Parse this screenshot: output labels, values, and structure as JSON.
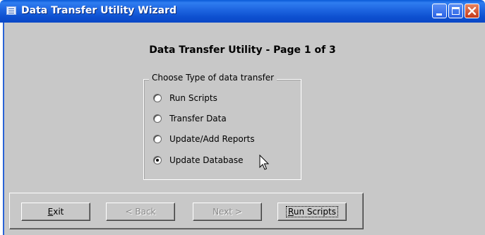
{
  "window": {
    "title": "Data Transfer Utility Wizard",
    "app_icon": "form-window-icon",
    "controls": [
      "minimize-icon",
      "maximize-icon",
      "close-icon"
    ]
  },
  "main": {
    "page_title": "Data Transfer Utility - Page 1 of 3",
    "group_label": "Choose Type of data transfer",
    "options": [
      {
        "label": "Run Scripts",
        "selected": false
      },
      {
        "label": "Transfer Data",
        "selected": false
      },
      {
        "label": "Update/Add Reports",
        "selected": false
      },
      {
        "label": "Update Database",
        "selected": true
      }
    ]
  },
  "buttons": {
    "exit_label": "Exit",
    "exit_mnemonic": "E",
    "exit_rest": "xit",
    "back_label": "< Back",
    "back_enabled": false,
    "next_label": "Next >",
    "next_enabled": false,
    "run_label": "Run Scripts",
    "run_mnemonic": "R",
    "run_rest": "un Scripts"
  },
  "colors": {
    "titlebar": "#0a50d0",
    "client_background": "#c8c8c8",
    "disabled_text": "#8a8a8a"
  }
}
